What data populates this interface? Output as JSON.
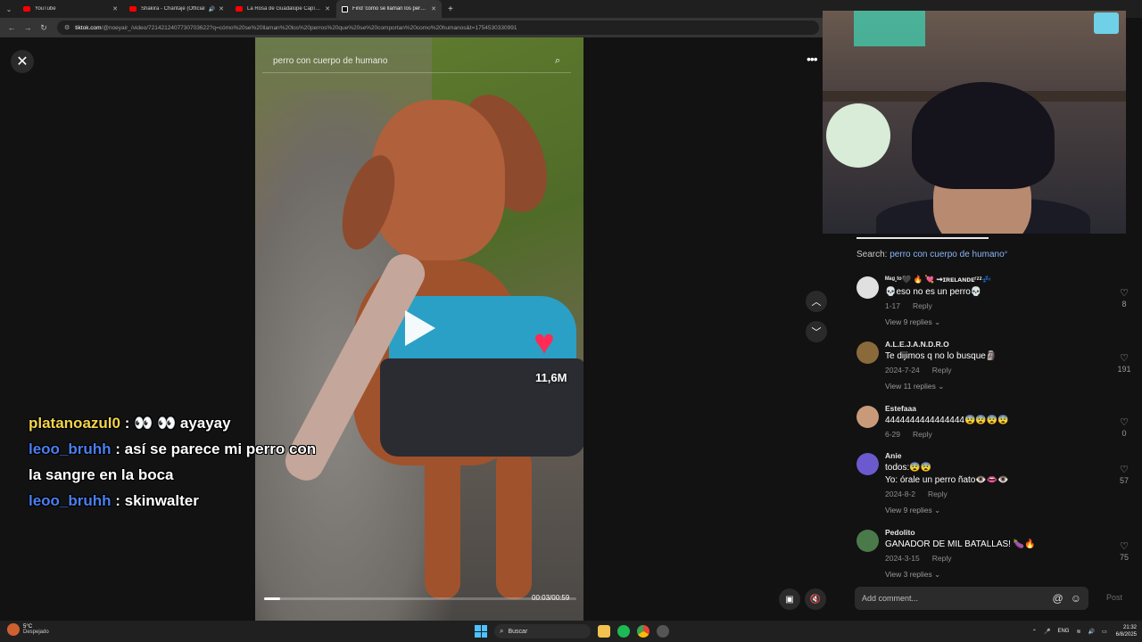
{
  "browser": {
    "tabs": [
      {
        "label": "YouTube",
        "type": "youtube",
        "speaker": false,
        "active": false
      },
      {
        "label": "Shakira - Chantaje (Official",
        "type": "youtube",
        "speaker": true,
        "active": false
      },
      {
        "label": "La Rosa de Guadalupe Capítulo",
        "type": "youtube",
        "speaker": false,
        "active": false
      },
      {
        "label": "Find 'cómo se llaman los perros",
        "type": "tiktok",
        "speaker": false,
        "active": true
      }
    ],
    "url_domain": "tiktok.com",
    "url_path": "/@noeyair_/video/7214212407730703622?q=cómo%20se%20llaman%20los%20perros%20que%20se%20comportan%20como%20humanos&t=1754530330991"
  },
  "video": {
    "search_text": "perro con cuerpo de humano",
    "like_count": "11,6M",
    "time": "00:03/00:59",
    "progress": 0.05
  },
  "stream_chat": [
    {
      "user": "platanoazul0",
      "text": "👀 👀 ayayay",
      "color": "#f2d44c"
    },
    {
      "user": "leoo_bruhh",
      "text": "así se parece mi perro con la sangre en la boca",
      "color": "#4a7ff0"
    },
    {
      "user": "leoo_bruhh",
      "text": "skinwalter",
      "color": "#4a7ff0"
    }
  ],
  "comments_panel": {
    "search_label": "Search:",
    "search_query": "perro con cuerpo de humano",
    "items": [
      {
        "user": "ᴹᵃᵍ.ᵗᵒ🖤 🔥 💘 ⇝ɪʀᴇʟᴀɴᴅᴇʳᶻᶻ💤",
        "text": "💀eso no es un perro💀",
        "date": "1-17",
        "reply": "Reply",
        "replies": "View 9 replies",
        "likes": "8",
        "avatar": "#e0e0e0"
      },
      {
        "user": "A.L.E.J.A.N.D.R.O",
        "text": "Te dijimos q no lo busque🗿",
        "date": "2024-7-24",
        "reply": "Reply",
        "replies": "View 11 replies",
        "likes": "191",
        "avatar": "#8a6a3a"
      },
      {
        "user": "Estefaaa",
        "text": "4444444444444444😨😨😨😨",
        "date": "6-29",
        "reply": "Reply",
        "replies": "",
        "likes": "0",
        "avatar": "#c99a7a"
      },
      {
        "user": "Anie",
        "text": "todos:😨😨",
        "text2": "Yo: órale un perro ñato👁️👄👁️",
        "date": "2024-8-2",
        "reply": "Reply",
        "replies": "View 9 replies",
        "likes": "57",
        "avatar": "#6a5acd"
      },
      {
        "user": "Pedolito",
        "text": "GANADOR DE MIL BATALLAS! 🍆🔥",
        "date": "2024-3-15",
        "reply": "Reply",
        "replies": "View 3 replies",
        "likes": "75",
        "avatar": "#4a7a4a"
      }
    ],
    "comment_placeholder": "Add comment...",
    "post_label": "Post"
  },
  "taskbar": {
    "temperature": "5°C",
    "weather": "Despejado",
    "search_placeholder": "Buscar",
    "lang": "ENG",
    "time": "21:32",
    "date": "6/8/2025"
  }
}
